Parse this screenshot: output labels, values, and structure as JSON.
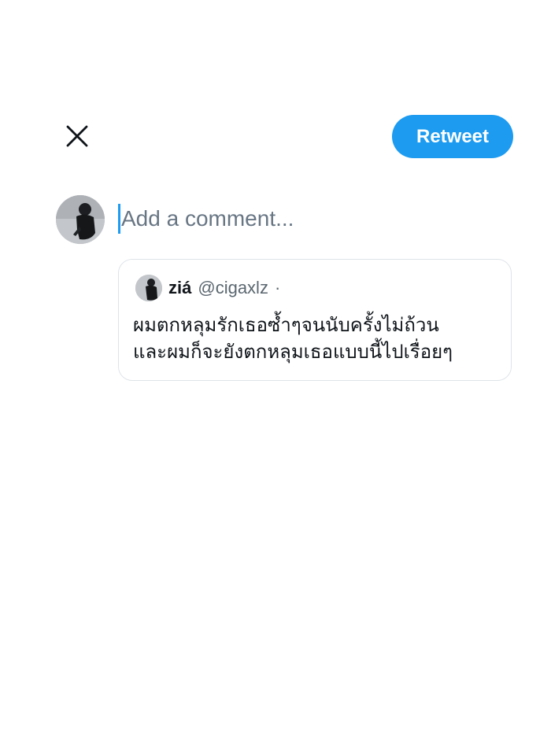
{
  "header": {
    "close_icon": "close-icon",
    "retweet_label": "Retweet",
    "accent_color": "#1d9bf0"
  },
  "composer": {
    "avatar_icon": "user-avatar",
    "placeholder": "Add a comment..."
  },
  "quoted_tweet": {
    "name": "ziá",
    "handle": "@cigaxlz",
    "separator": "·",
    "text_lines": [
      "ผมตกหลุมรักเธอซ้ำๆจนนับครั้งไม่ถ้วน",
      "และผมก็จะยังตกหลุมเธอแบบนี้ไปเรื่อยๆ"
    ]
  }
}
